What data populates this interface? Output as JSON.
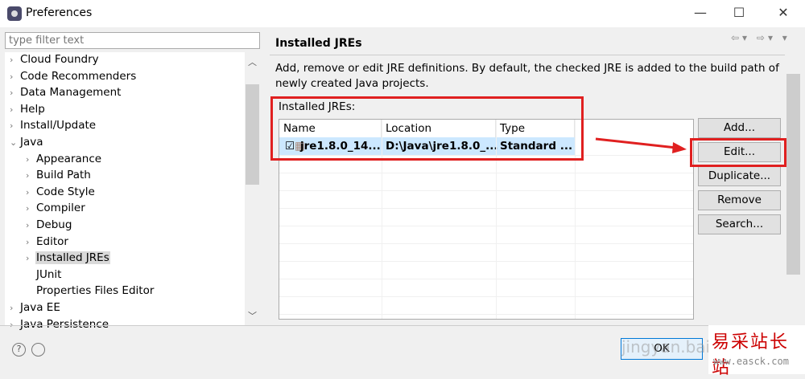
{
  "window": {
    "title": "Preferences",
    "minimize": "—",
    "maximize": "☐",
    "close": "✕"
  },
  "filter": {
    "placeholder": "type filter text"
  },
  "tree": [
    {
      "label": "Cloud Foundry",
      "level": 0,
      "chevron": "›"
    },
    {
      "label": "Code Recommenders",
      "level": 0,
      "chevron": "›"
    },
    {
      "label": "Data Management",
      "level": 0,
      "chevron": "›"
    },
    {
      "label": "Help",
      "level": 0,
      "chevron": "›"
    },
    {
      "label": "Install/Update",
      "level": 0,
      "chevron": "›"
    },
    {
      "label": "Java",
      "level": 0,
      "chevron": "⌄"
    },
    {
      "label": "Appearance",
      "level": 1,
      "chevron": "›"
    },
    {
      "label": "Build Path",
      "level": 1,
      "chevron": "›"
    },
    {
      "label": "Code Style",
      "level": 1,
      "chevron": "›"
    },
    {
      "label": "Compiler",
      "level": 1,
      "chevron": "›"
    },
    {
      "label": "Debug",
      "level": 1,
      "chevron": "›"
    },
    {
      "label": "Editor",
      "level": 1,
      "chevron": "›"
    },
    {
      "label": "Installed JREs",
      "level": 1,
      "chevron": "›",
      "selected": true
    },
    {
      "label": "JUnit",
      "level": 1,
      "chevron": ""
    },
    {
      "label": "Properties Files Editor",
      "level": 1,
      "chevron": ""
    },
    {
      "label": "Java EE",
      "level": 0,
      "chevron": "›"
    },
    {
      "label": "Java Persistence",
      "level": 0,
      "chevron": "›"
    }
  ],
  "page": {
    "title": "Installed JREs",
    "nav": "⇦▾ ⇨▾ ▾",
    "description": "Add, remove or edit JRE definitions. By default, the checked JRE is added to the build path of newly created Java projects.",
    "list_label": "Installed JREs:",
    "columns": [
      "Name",
      "Location",
      "Type"
    ],
    "rows": [
      {
        "checked": true,
        "name": "jre1.8.0_14...",
        "location": "D:\\Java\\jre1.8.0_...",
        "type": "Standard ..."
      }
    ],
    "buttons": {
      "add": "Add...",
      "edit": "Edit...",
      "duplicate": "Duplicate...",
      "remove": "Remove",
      "search": "Search..."
    }
  },
  "footer": {
    "help": "?",
    "ok": "OK"
  },
  "watermark": {
    "cn": "易采站长站",
    "url": "www.easck.com",
    "overlay": "jingyan.baidu"
  }
}
